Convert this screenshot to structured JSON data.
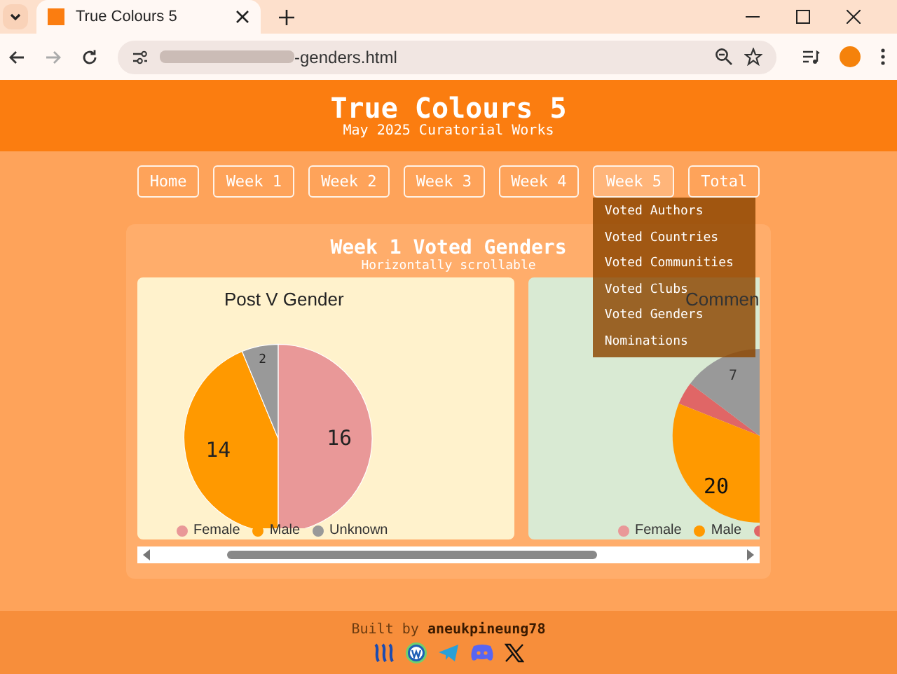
{
  "browser": {
    "tab_title": "True Colours 5",
    "address": "-genders.html"
  },
  "header": {
    "title": "True Colours 5",
    "subtitle": "May 2025 Curatorial Works"
  },
  "nav": [
    {
      "label": "Home",
      "selected": false
    },
    {
      "label": "Week 1",
      "selected": false
    },
    {
      "label": "Week 2",
      "selected": false
    },
    {
      "label": "Week 3",
      "selected": false
    },
    {
      "label": "Week 4",
      "selected": false
    },
    {
      "label": "Week 5",
      "selected": true
    },
    {
      "label": "Total",
      "selected": false
    }
  ],
  "dropdown": [
    "Voted Authors",
    "Voted Countries",
    "Voted Communities",
    "Voted Clubs",
    "Voted Genders",
    "Nominations"
  ],
  "section": {
    "title": "Week 1 Voted Genders",
    "subtitle": "Horizontally scrollable"
  },
  "chart_1": {
    "chart_data": {
      "type": "pie",
      "title": "Post V Gender",
      "legend": "bottom",
      "data_labels": true,
      "categories": [
        "Female",
        "Male",
        "Unknown"
      ],
      "values": [
        16,
        14,
        2
      ],
      "colors": [
        "#e99898",
        "#ff9900",
        "#999999"
      ]
    }
  },
  "chart_2": {
    "title": "Commen",
    "slice_labels": [
      "7",
      "20"
    ],
    "legend": [
      {
        "label": "Female",
        "color": "#e99898"
      },
      {
        "label": "Male",
        "color": "#ff9900"
      },
      {
        "color": "#e06666"
      }
    ]
  },
  "footer": {
    "credit": "Built by **aneukpineung78**"
  }
}
